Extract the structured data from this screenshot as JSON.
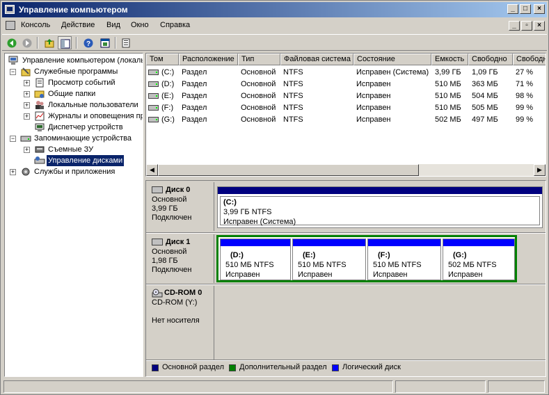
{
  "window": {
    "title": "Управление компьютером"
  },
  "menu": {
    "items": [
      "Консоль",
      "Действие",
      "Вид",
      "Окно",
      "Справка"
    ]
  },
  "tree": {
    "root": "Управление компьютером (локаль",
    "items": [
      "Служебные программы",
      "Просмотр событий",
      "Общие папки",
      "Локальные пользователи",
      "Журналы и оповещения пр",
      "Диспетчер устройств",
      "Запоминающие устройства",
      "Съемные ЗУ",
      "Управление дисками",
      "Службы и приложения"
    ]
  },
  "volumes": {
    "columns": [
      "Том",
      "Расположение",
      "Тип",
      "Файловая система",
      "Состояние",
      "Емкость",
      "Свободно",
      "Свободно"
    ],
    "rows": [
      [
        "(C:)",
        "Раздел",
        "Основной",
        "NTFS",
        "Исправен (Система)",
        "3,99 ГБ",
        "1,09 ГБ",
        "27 %"
      ],
      [
        "(D:)",
        "Раздел",
        "Основной",
        "NTFS",
        "Исправен",
        "510 МБ",
        "363 МБ",
        "71 %"
      ],
      [
        "(E:)",
        "Раздел",
        "Основной",
        "NTFS",
        "Исправен",
        "510 МБ",
        "504 МБ",
        "98 %"
      ],
      [
        "(F:)",
        "Раздел",
        "Основной",
        "NTFS",
        "Исправен",
        "510 МБ",
        "505 МБ",
        "99 %"
      ],
      [
        "(G:)",
        "Раздел",
        "Основной",
        "NTFS",
        "Исправен",
        "502 МБ",
        "497 МБ",
        "99 %"
      ]
    ]
  },
  "disks": [
    {
      "name": "Диск 0",
      "type": "Основной",
      "size": "3,99 ГБ",
      "status": "Подключен",
      "partitions": [
        {
          "label": "(C:)",
          "size": "3,99 ГБ NTFS",
          "state": "Исправен (Система)"
        }
      ]
    },
    {
      "name": "Диск 1",
      "type": "Основной",
      "size": "1,98 ГБ",
      "status": "Подключен",
      "partitions": [
        {
          "label": "(D:)",
          "size": "510 МБ NTFS",
          "state": "Исправен"
        },
        {
          "label": "(E:)",
          "size": "510 МБ NTFS",
          "state": "Исправен"
        },
        {
          "label": "(F:)",
          "size": "510 МБ NTFS",
          "state": "Исправен"
        },
        {
          "label": "(G:)",
          "size": "502 МБ NTFS",
          "state": "Исправен"
        }
      ]
    },
    {
      "name": "CD-ROM 0",
      "drive": "CD-ROM (Y:)",
      "media": "Нет носителя"
    }
  ],
  "legend": {
    "primary": "Основной раздел",
    "extended": "Дополнительный раздел",
    "logical": "Логический диск"
  },
  "colors": {
    "primary": "#00007f",
    "extended": "#008000",
    "logical": "#0000ff",
    "titlebar": "#0a246a"
  }
}
